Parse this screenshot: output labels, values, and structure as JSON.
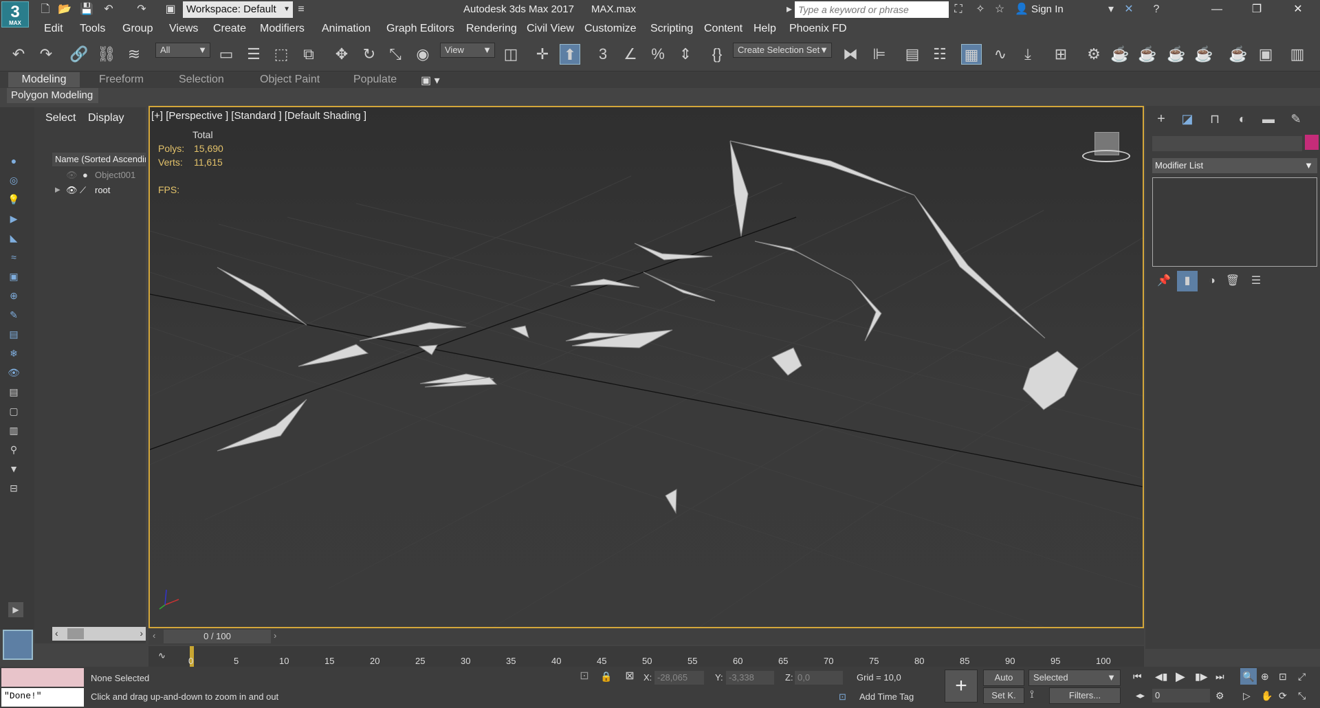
{
  "titlebar": {
    "logo_text": "3",
    "logo_sub": "MAX",
    "workspace": "Workspace: Default",
    "title": "Autodesk 3ds Max 2017      MAX.max",
    "search_placeholder": "Type a keyword or phrase",
    "signin": "Sign In"
  },
  "menus": [
    "Edit",
    "Tools",
    "Group",
    "Views",
    "Create",
    "Modifiers",
    "Animation",
    "Graph Editors",
    "Rendering",
    "Civil View",
    "Customize",
    "Scripting",
    "Content",
    "Help",
    "Phoenix FD"
  ],
  "toolbar": {
    "filter": "All",
    "ref_coord": "View",
    "selection_set": "Create Selection Set"
  },
  "ribbon": {
    "tabs": [
      "Modeling",
      "Freeform",
      "Selection",
      "Object Paint",
      "Populate"
    ],
    "panel": "Polygon Modeling"
  },
  "explorer": {
    "tabs": [
      "Select",
      "Display"
    ],
    "column": "Name (Sorted Ascending)",
    "items": [
      "Object001",
      "root"
    ]
  },
  "viewport": {
    "label": "[+] [Perspective ] [Standard ] [Default Shading ]",
    "stats_header": "Total",
    "polys_label": "Polys:",
    "polys": "15,690",
    "verts_label": "Verts:",
    "verts": "11,615",
    "fps_label": "FPS:"
  },
  "command_panel": {
    "modifier_list": "Modifier List",
    "accent": "#c52c79"
  },
  "timeline": {
    "slider": "0 / 100",
    "ticks": [
      "0",
      "5",
      "10",
      "15",
      "20",
      "25",
      "30",
      "35",
      "40",
      "45",
      "50",
      "55",
      "60",
      "65",
      "70",
      "75",
      "80",
      "85",
      "90",
      "95",
      "100"
    ]
  },
  "status": {
    "maxscript_output": "\"Done!\"",
    "selection": "None Selected",
    "prompt": "Click and drag up-and-down to zoom in and out",
    "x_label": "X:",
    "x": "-28,065",
    "y_label": "Y:",
    "y": "-3,338",
    "z_label": "Z:",
    "z": "0,0",
    "grid": "Grid = 10,0",
    "add_time_tag": "Add Time Tag",
    "auto": "Auto",
    "set_key": "Set K.",
    "key_filter": "Selected",
    "filters": "Filters...",
    "frame": "0"
  }
}
